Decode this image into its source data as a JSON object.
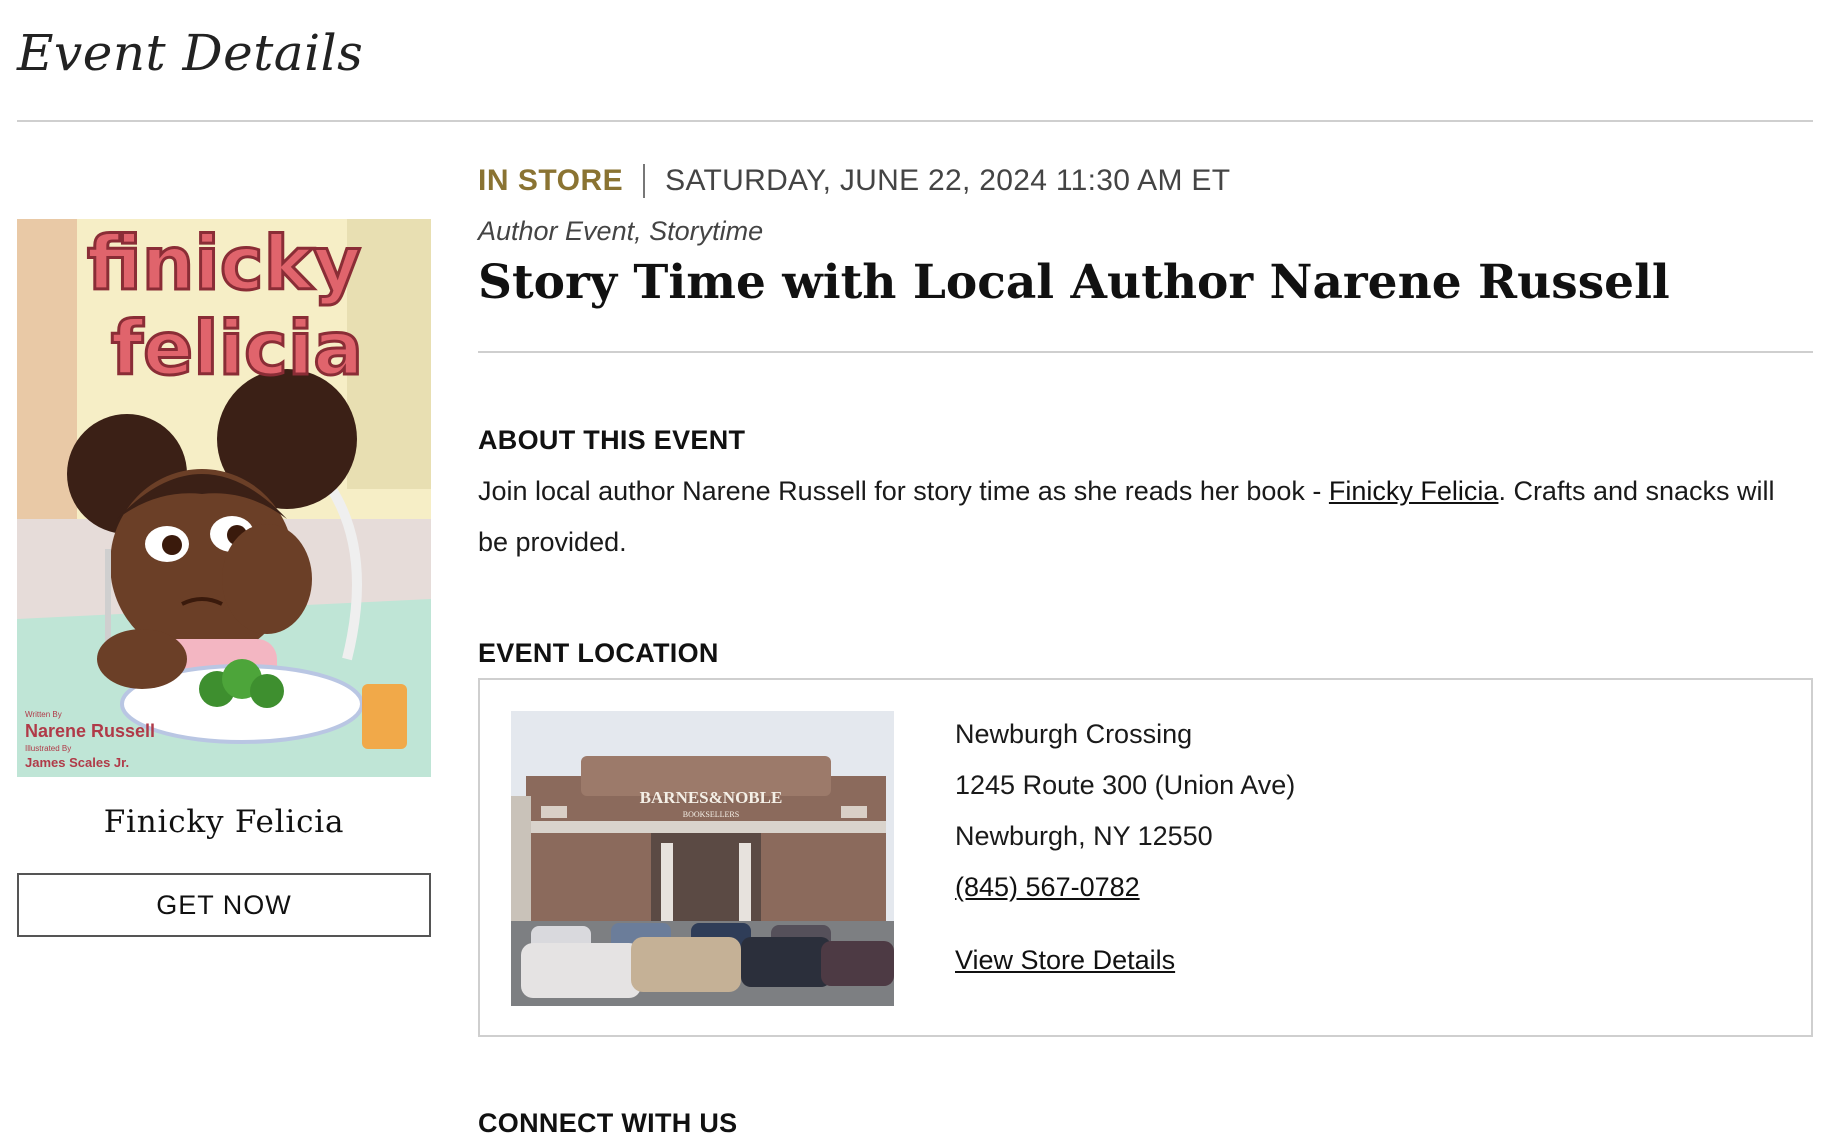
{
  "page": {
    "title": "Event Details"
  },
  "book": {
    "cover_title_line1": "finicky",
    "cover_title_line2": "felicia",
    "cover_written_by": "Written By",
    "cover_author": "Narene Russell",
    "cover_illustrated_by": "Illustrated By",
    "cover_illustrator": "James Scales Jr.",
    "title": "Finicky Felicia",
    "button_label": "GET NOW"
  },
  "event": {
    "format": "IN STORE",
    "datetime": "SATURDAY, JUNE 22, 2024 11:30 AM ET",
    "categories": "Author Event, Storytime",
    "title": "Story Time with Local Author Narene Russell"
  },
  "about": {
    "heading": "ABOUT THIS EVENT",
    "text_before_link": "Join local author Narene Russell for story time as she reads her book - ",
    "link_text": "Finicky Felicia",
    "text_after_link": ".  Crafts and snacks will be provided."
  },
  "location": {
    "heading": "EVENT LOCATION",
    "store_sign_line1": "BARNES&NOBLE",
    "store_sign_line2": "BOOKSELLERS",
    "store_name": "Newburgh Crossing",
    "address_line1": "1245 Route 300 (Union Ave)",
    "address_line2": "Newburgh, NY 12550",
    "phone": "(845) 567-0782",
    "details_link": "View Store Details"
  },
  "connect": {
    "heading": "CONNECT WITH US"
  },
  "colors": {
    "accent_gold": "#8a7332",
    "rule": "#cfcfcf",
    "text": "#111111"
  }
}
